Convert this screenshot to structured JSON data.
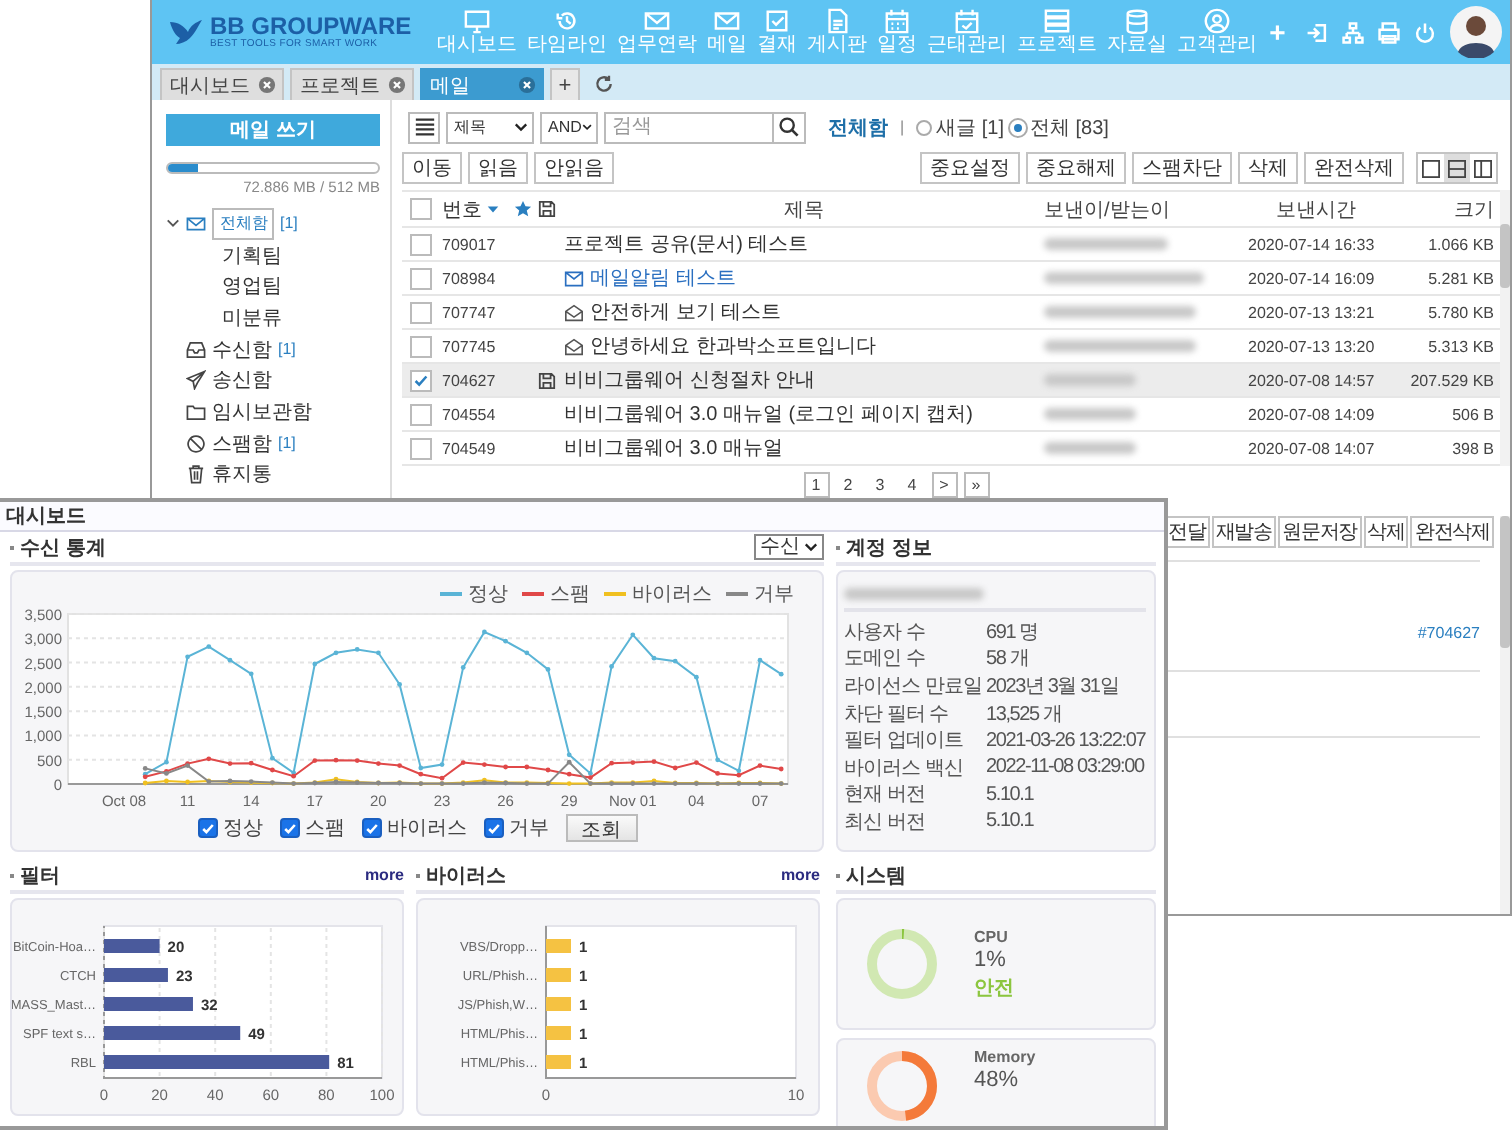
{
  "mail_window": {
    "logo": {
      "name": "BB GROUPWARE",
      "tagline": "BEST TOOLS FOR SMART WORK"
    },
    "nav": [
      {
        "label": "대시보드"
      },
      {
        "label": "타임라인"
      },
      {
        "label": "업무연락"
      },
      {
        "label": "메일"
      },
      {
        "label": "결재"
      },
      {
        "label": "게시판"
      },
      {
        "label": "일정"
      },
      {
        "label": "근태관리"
      },
      {
        "label": "프로젝트"
      },
      {
        "label": "자료실"
      },
      {
        "label": "고객관리"
      }
    ],
    "nav_add": "+",
    "tabs": [
      {
        "label": "대시보드",
        "selected": false
      },
      {
        "label": "프로젝트",
        "selected": false
      },
      {
        "label": "메일",
        "selected": true
      }
    ],
    "tab_add": "+",
    "sidebar": {
      "compose": "메일 쓰기",
      "storage": {
        "level": 0.14,
        "reading": "72.886 MB / 512 MB"
      },
      "folders": [
        {
          "label": "전체함",
          "count": "[1]",
          "expanded": true,
          "selected": true,
          "children": [
            {
              "label": "기획팀"
            },
            {
              "label": "영업팀"
            },
            {
              "label": "미분류"
            }
          ]
        },
        {
          "label": "수신함",
          "count": "[1]",
          "expanded": false,
          "selected": false
        },
        {
          "label": "송신함",
          "expanded": false,
          "selected": false
        },
        {
          "label": "임시보관함",
          "expanded": false,
          "selected": false
        },
        {
          "label": "스팸함",
          "count": "[1]",
          "expanded": false,
          "selected": false
        },
        {
          "label": "휴지통",
          "expanded": false,
          "selected": false
        }
      ]
    },
    "toolbar": {
      "field_select": "제목",
      "op_select": "AND",
      "search": {
        "placeholder": "검색"
      },
      "folder_label": "전체함",
      "separator": "|",
      "filters": [
        {
          "label": "새글 [1]",
          "selected": false
        },
        {
          "label": "전체 [83]",
          "selected": true
        }
      ],
      "left_buttons": [
        "이동",
        "읽음",
        "안읽음"
      ],
      "right_buttons": [
        "중요설정",
        "중요해제",
        "스팸차단",
        "삭제",
        "완전삭제"
      ],
      "views": [
        {
          "selected": false
        },
        {
          "selected": true
        },
        {
          "selected": false
        }
      ]
    },
    "table": {
      "select_all": {
        "checked": false
      },
      "columns": [
        "번호",
        "제목",
        "보낸이/받는이",
        "보낸시간",
        "크기"
      ],
      "rows": [
        {
          "checked": false,
          "saved": false,
          "kind": "plain",
          "number": "709017",
          "subject": "프로젝트 공유(문서) 테스트",
          "time": "2020-07-14 16:33",
          "size": "1.066 KB"
        },
        {
          "checked": false,
          "saved": false,
          "kind": "unread",
          "number": "708984",
          "subject": "메일알림 테스트",
          "time": "2020-07-14 16:09",
          "size": "5.281 KB"
        },
        {
          "checked": false,
          "saved": false,
          "kind": "opened",
          "number": "707747",
          "subject": "안전하게 보기 테스트",
          "time": "2020-07-13 13:21",
          "size": "5.780 KB"
        },
        {
          "checked": false,
          "saved": false,
          "kind": "opened",
          "number": "707745",
          "subject": "안녕하세요 한과박소프트입니다",
          "time": "2020-07-13 13:20",
          "size": "5.313 KB"
        },
        {
          "checked": true,
          "saved": true,
          "kind": "plain",
          "number": "704627",
          "subject": "비비그룹웨어 신청절차 안내",
          "time": "2020-07-08 14:57",
          "size": "207.529 KB"
        },
        {
          "checked": false,
          "saved": false,
          "kind": "plain",
          "number": "704554",
          "subject": "비비그룹웨어 3.0 매뉴얼 (로그인 페이지 캡처)",
          "time": "2020-07-08 14:09",
          "size": "506 B"
        },
        {
          "checked": false,
          "saved": false,
          "kind": "plain",
          "number": "704549",
          "subject": "비비그룹웨어 3.0 매뉴얼",
          "time": "2020-07-08 14:07",
          "size": "398 B"
        }
      ]
    },
    "pagination": {
      "pages": [
        {
          "label": "1",
          "selected": true
        },
        {
          "label": "2",
          "selected": false
        },
        {
          "label": "3",
          "selected": false
        },
        {
          "label": "4",
          "selected": false
        }
      ],
      "next": ">",
      "last": "»"
    },
    "preview": {
      "buttons": [
        "전달",
        "재발송",
        "원문저장",
        "삭제",
        "완전삭제"
      ],
      "ref": "#704627"
    }
  },
  "dashboard": {
    "title": "대시보드",
    "stats": {
      "title": "수신 통계",
      "select": "수신",
      "chart_data": {
        "type": "line",
        "grid": true,
        "categories": [
          "Oct 08",
          null,
          null,
          "11",
          null,
          null,
          "14",
          null,
          null,
          "17",
          null,
          null,
          "20",
          null,
          null,
          "23",
          null,
          null,
          "26",
          null,
          null,
          "29",
          null,
          null,
          "Nov 01",
          null,
          null,
          "04",
          null,
          null,
          "07",
          null
        ],
        "ylim": [
          0,
          3500
        ],
        "yticks": [
          {
            "value": 0,
            "label": "0"
          },
          {
            "value": 500,
            "label": "500"
          },
          {
            "value": 1000,
            "label": "1,000"
          },
          {
            "value": 1500,
            "label": "1,500"
          },
          {
            "value": 2000,
            "label": "2,000"
          },
          {
            "value": 2500,
            "label": "2,500"
          },
          {
            "value": 3000,
            "label": "3,000"
          },
          {
            "value": 3500,
            "label": "3,500"
          }
        ],
        "series": [
          {
            "name": "정상",
            "color": "#5ab4d6",
            "values": [
              null,
              200,
              450,
              2620,
              2830,
              2550,
              2270,
              530,
              230,
              2470,
              2700,
              2770,
              2700,
              2050,
              330,
              400,
              2400,
              3130,
              2940,
              2700,
              2360,
              600,
              220,
              2420,
              3070,
              2590,
              2530,
              2200,
              500,
              270,
              2550,
              2260
            ]
          },
          {
            "name": "스팸",
            "color": "#e04848",
            "values": [
              null,
              150,
              260,
              420,
              520,
              420,
              430,
              290,
              160,
              480,
              490,
              480,
              420,
              380,
              200,
              120,
              440,
              400,
              350,
              350,
              290,
              200,
              130,
              430,
              440,
              460,
              330,
              440,
              220,
              180,
              380,
              310
            ]
          },
          {
            "name": "바이러스",
            "color": "#f0c020",
            "values": [
              null,
              20,
              60,
              40,
              60,
              40,
              30,
              20,
              10,
              30,
              100,
              40,
              20,
              30,
              10,
              10,
              30,
              80,
              30,
              30,
              20,
              10,
              10,
              30,
              30,
              60,
              20,
              20,
              10,
              20,
              20,
              10
            ]
          },
          {
            "name": "거부",
            "color": "#888888",
            "values": [
              null,
              320,
              220,
              380,
              50,
              60,
              50,
              30,
              10,
              20,
              40,
              30,
              20,
              20,
              10,
              10,
              10,
              30,
              20,
              10,
              10,
              450,
              10,
              10,
              10,
              10,
              10,
              10,
              10,
              10,
              10,
              10
            ]
          }
        ]
      },
      "filters": [
        {
          "label": "정상",
          "checked": true
        },
        {
          "label": "스팸",
          "checked": true
        },
        {
          "label": "바이러스",
          "checked": true
        },
        {
          "label": "거부",
          "checked": true
        }
      ],
      "query_button": "조회"
    },
    "account": {
      "title": "계정 정보",
      "rows": [
        {
          "label": "사용자 수",
          "value": "691 명"
        },
        {
          "label": "도메인 수",
          "value": "58 개"
        },
        {
          "label": "라이선스 만료일",
          "value": "2023년 3월 31일"
        },
        {
          "label": "차단 필터 수",
          "value": "13,525 개"
        },
        {
          "label": "필터 업데이트",
          "value": "2021-03-26 13:22:07"
        },
        {
          "label": "바이러스 백신",
          "value": "2022-11-08 03:29:00"
        },
        {
          "label": "현재 버전",
          "value": "5.10.1"
        },
        {
          "label": "최신 버전",
          "value": "5.10.1"
        }
      ]
    },
    "filter": {
      "title": "필터",
      "more": "more",
      "chart_data": {
        "type": "bar",
        "orientation": "horizontal",
        "categories": [
          "BitCoin-Hoa…",
          "CTCH",
          "MASS_Mast…",
          "SPF text s…",
          "RBL"
        ],
        "series": [
          {
            "color": "#4a5a9c",
            "values": [
              20,
              23,
              32,
              49,
              81
            ]
          }
        ],
        "xlim": [
          0,
          100
        ],
        "xticks": [
          0,
          20,
          40,
          60,
          80,
          100
        ],
        "grid": true,
        "data_labels": true
      }
    },
    "virus": {
      "title": "바이러스",
      "more": "more",
      "chart_data": {
        "type": "bar",
        "orientation": "horizontal",
        "categories": [
          "VBS/Dropp…",
          "URL/Phish…",
          "JS/Phish,W…",
          "HTML/Phis…",
          "HTML/Phis…"
        ],
        "series": [
          {
            "color": "#f5c242",
            "values": [
              1,
              1,
              1,
              1,
              1
            ]
          }
        ],
        "xlim": [
          0,
          10
        ],
        "xticks": [
          0,
          10
        ],
        "data_labels": true
      }
    },
    "system": {
      "title": "시스템",
      "items": [
        {
          "name": "CPU",
          "reading": "1%",
          "status": "안전",
          "level": 0.01,
          "color": "#8cc63f"
        },
        {
          "name": "Memory",
          "reading": "48%",
          "level": 0.48,
          "color": "#f47a3a"
        }
      ]
    }
  }
}
